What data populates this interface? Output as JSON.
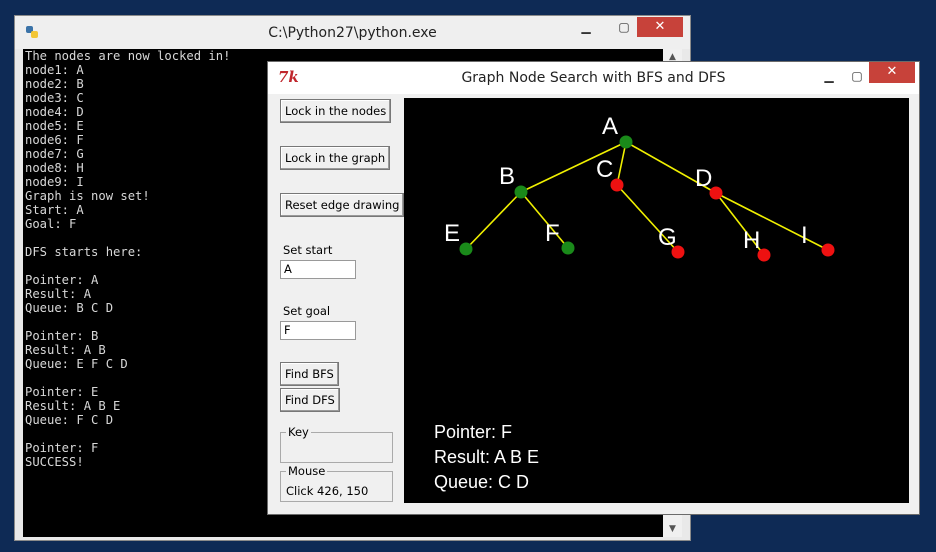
{
  "console": {
    "title": "C:\\Python27\\python.exe",
    "lines": [
      "The nodes are now locked in!",
      "node1: A",
      "node2: B",
      "node3: C",
      "node4: D",
      "node5: E",
      "node6: F",
      "node7: G",
      "node8: H",
      "node9: I",
      "Graph is now set!",
      "Start: A",
      "Goal: F",
      "",
      "DFS starts here:",
      "",
      "Pointer: A",
      "Result: A",
      "Queue: B C D",
      "",
      "Pointer: B",
      "Result: A B",
      "Queue: E F C D",
      "",
      "Pointer: E",
      "Result: A B E",
      "Queue: F C D",
      "",
      "Pointer: F",
      "SUCCESS!"
    ]
  },
  "tk": {
    "title": "Graph Node Search with BFS and DFS",
    "buttons": {
      "lock_nodes": "Lock in the nodes",
      "lock_graph": "Lock in the graph",
      "reset_edges": "Reset edge drawing",
      "find_bfs": "Find BFS",
      "find_dfs": "Find DFS"
    },
    "set_start_label": "Set start",
    "start_value": "A",
    "set_goal_label": "Set goal",
    "goal_value": "F",
    "key_label": "Key",
    "mouse_label": "Mouse",
    "mouse_text": "Click 426, 150"
  },
  "graph": {
    "colors": {
      "visited": "#1a8a1a",
      "unvisited": "#ee1111",
      "edge": "#f0f000",
      "label": "#ffffff"
    },
    "nodes": [
      {
        "name": "A",
        "state": "visited"
      },
      {
        "name": "B",
        "state": "visited"
      },
      {
        "name": "C",
        "state": "unvisited"
      },
      {
        "name": "D",
        "state": "unvisited"
      },
      {
        "name": "E",
        "state": "visited"
      },
      {
        "name": "F",
        "state": "visited"
      },
      {
        "name": "G",
        "state": "unvisited"
      },
      {
        "name": "H",
        "state": "unvisited"
      },
      {
        "name": "I",
        "state": "unvisited"
      }
    ],
    "edges": [
      [
        "A",
        "B"
      ],
      [
        "A",
        "C"
      ],
      [
        "A",
        "D"
      ],
      [
        "B",
        "E"
      ],
      [
        "B",
        "F"
      ],
      [
        "C",
        "G"
      ],
      [
        "D",
        "H"
      ],
      [
        "D",
        "I"
      ]
    ],
    "status": {
      "pointer": "Pointer: F",
      "result": "Result: A B E",
      "queue": "Queue: C D"
    }
  }
}
